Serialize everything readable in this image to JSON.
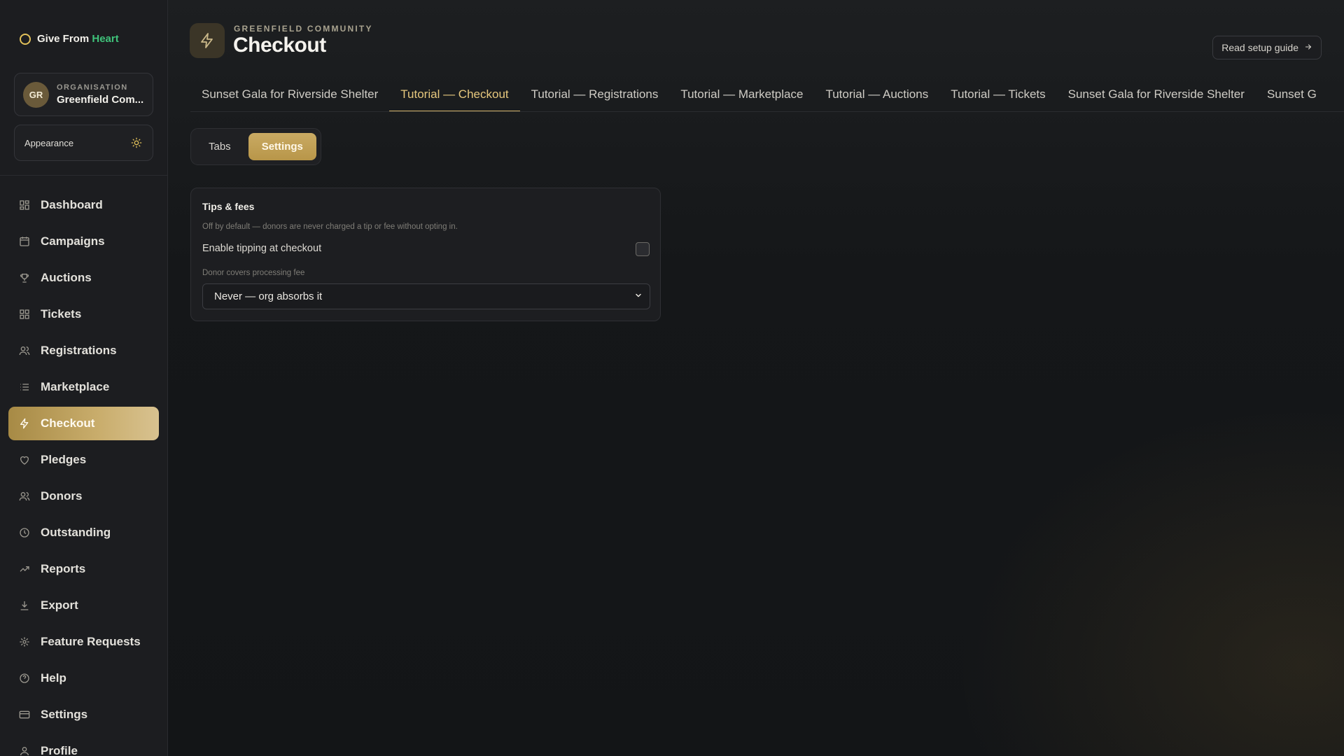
{
  "brand": {
    "prefix": "Give From",
    "accent": "Heart"
  },
  "org": {
    "initials": "GR",
    "label": "ORGANISATION",
    "name": "Greenfield Com..."
  },
  "appearance": {
    "label": "Appearance",
    "icon": "sun-icon"
  },
  "nav": [
    {
      "label": "Dashboard",
      "icon": "dashboard-grid-icon"
    },
    {
      "label": "Campaigns",
      "icon": "calendar-icon"
    },
    {
      "label": "Auctions",
      "icon": "trophy-icon"
    },
    {
      "label": "Tickets",
      "icon": "tickets-grid-icon"
    },
    {
      "label": "Registrations",
      "icon": "users-icon"
    },
    {
      "label": "Marketplace",
      "icon": "list-icon"
    },
    {
      "label": "Checkout",
      "icon": "bolt-icon",
      "active": true
    },
    {
      "label": "Pledges",
      "icon": "heart-icon"
    },
    {
      "label": "Donors",
      "icon": "users-icon"
    },
    {
      "label": "Outstanding",
      "icon": "clock-icon"
    },
    {
      "label": "Reports",
      "icon": "trend-icon"
    },
    {
      "label": "Export",
      "icon": "download-icon"
    },
    {
      "label": "Feature Requests",
      "icon": "sparkle-icon"
    },
    {
      "label": "Help",
      "icon": "help-icon"
    },
    {
      "label": "Settings",
      "icon": "card-icon"
    },
    {
      "label": "Profile",
      "icon": "user-icon"
    }
  ],
  "header": {
    "overline": "GREENFIELD COMMUNITY",
    "title": "Checkout",
    "guide_button": "Read setup guide"
  },
  "tabs": [
    {
      "label": "Sunset Gala for Riverside Shelter"
    },
    {
      "label": "Tutorial — Checkout",
      "active": true
    },
    {
      "label": "Tutorial — Registrations"
    },
    {
      "label": "Tutorial — Marketplace"
    },
    {
      "label": "Tutorial — Auctions"
    },
    {
      "label": "Tutorial — Tickets"
    },
    {
      "label": "Sunset Gala for Riverside Shelter"
    },
    {
      "label": "Sunset G"
    }
  ],
  "segmented": {
    "tabs_label": "Tabs",
    "settings_label": "Settings",
    "active": "Settings"
  },
  "tips_card": {
    "title": "Tips & fees",
    "hint": "Off by default — donors are never charged a tip or fee without opting in.",
    "tipping_label": "Enable tipping at checkout",
    "tipping_enabled": false,
    "fee_label": "Donor covers processing fee",
    "fee_value": "Never — org absorbs it"
  },
  "colors": {
    "accent_gold": "#c9aa63",
    "brand_green": "#3fc27a",
    "background": "#141619"
  }
}
